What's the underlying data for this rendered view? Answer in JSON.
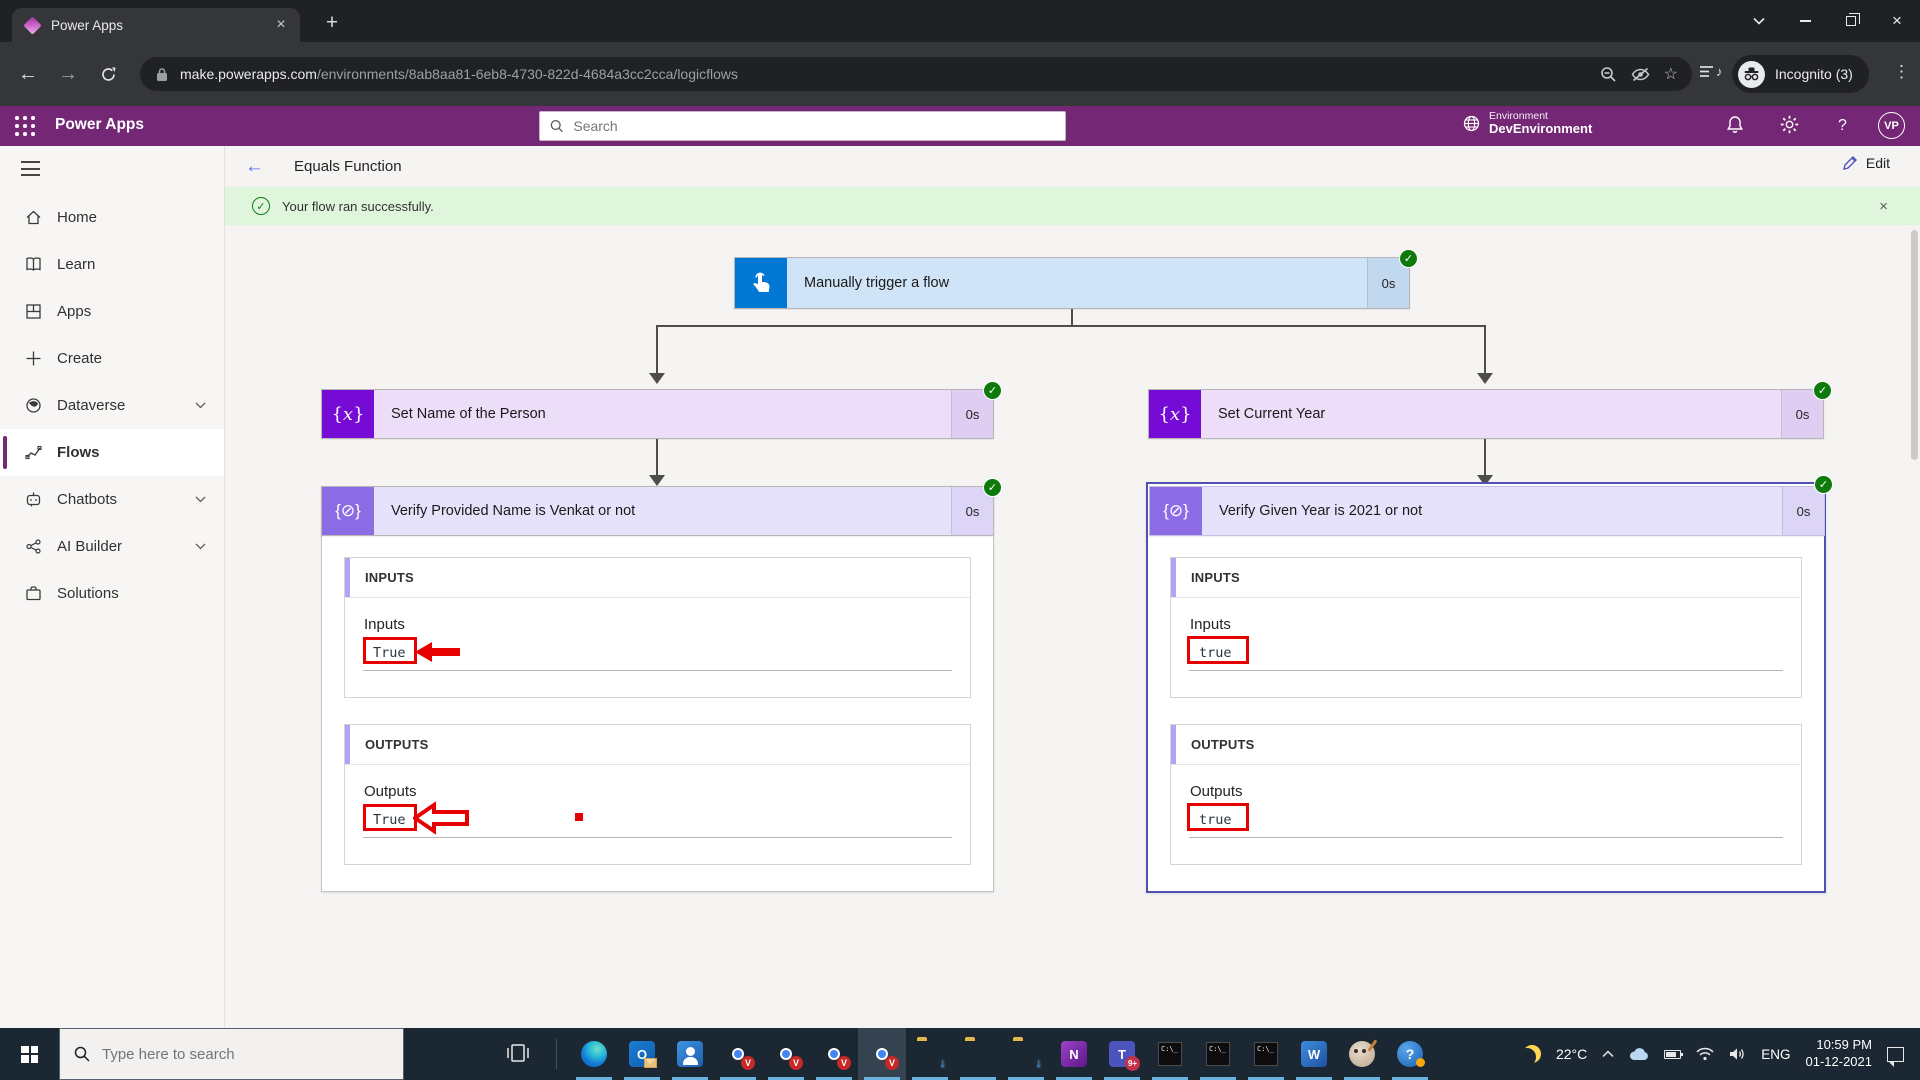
{
  "browser": {
    "tab_title": "Power Apps",
    "url_domain": "make.powerapps.com",
    "url_path": "/environments/8ab8aa81-6eb8-4730-822d-4684a3cc2cca/logicflows",
    "incognito_label": "Incognito (3)"
  },
  "app_header": {
    "brand": "Power Apps",
    "search_placeholder": "Search",
    "environment_label": "Environment",
    "environment_name": "DevEnvironment",
    "avatar_initials": "VP"
  },
  "sidebar": {
    "items": [
      {
        "label": "Home",
        "icon": "home-icon"
      },
      {
        "label": "Learn",
        "icon": "book-icon"
      },
      {
        "label": "Apps",
        "icon": "apps-grid-icon"
      },
      {
        "label": "Create",
        "icon": "plus-icon"
      },
      {
        "label": "Dataverse",
        "icon": "dataverse-icon",
        "chevron": true
      },
      {
        "label": "Flows",
        "icon": "flows-icon",
        "selected": true
      },
      {
        "label": "Chatbots",
        "icon": "chatbot-icon",
        "chevron": true
      },
      {
        "label": "AI Builder",
        "icon": "ai-builder-icon",
        "chevron": true
      },
      {
        "label": "Solutions",
        "icon": "solutions-icon"
      }
    ]
  },
  "page": {
    "title": "Equals Function",
    "edit_label": "Edit",
    "banner_text": "Your flow ran successfully."
  },
  "flow": {
    "trigger": {
      "title": "Manually trigger a flow",
      "duration": "0s"
    },
    "set_name": {
      "title": "Set Name of the Person",
      "duration": "0s"
    },
    "set_year": {
      "title": "Set Current Year",
      "duration": "0s"
    },
    "verify_name": {
      "title": "Verify Provided Name is Venkat or not",
      "duration": "0s",
      "inputs_header": "INPUTS",
      "inputs_label": "Inputs",
      "inputs_value": "True",
      "outputs_header": "OUTPUTS",
      "outputs_label": "Outputs",
      "outputs_value": "True"
    },
    "verify_year": {
      "title": "Verify Given Year is 2021 or not",
      "duration": "0s",
      "inputs_header": "INPUTS",
      "inputs_label": "Inputs",
      "inputs_value": "true",
      "outputs_header": "OUTPUTS",
      "outputs_label": "Outputs",
      "outputs_value": "true"
    }
  },
  "taskbar": {
    "search_placeholder": "Type here to search",
    "icons": [
      "edge",
      "outlook",
      "people",
      "chrome",
      "chrome",
      "chrome",
      "chrome-active",
      "folder-download",
      "folder",
      "folder-download",
      "onenote",
      "teams",
      "terminal",
      "terminal",
      "terminal",
      "word",
      "gimp",
      "get-help"
    ],
    "tray": {
      "temperature": "22°C",
      "language": "ENG",
      "time": "10:59 PM",
      "date": "01-12-2021"
    }
  },
  "glyphs": {
    "close": "×",
    "plus": "+",
    "check": "✓",
    "back": "←",
    "forward": "→",
    "kebab": "⋮",
    "star": "☆",
    "note": "♪",
    "help": "?",
    "var_open": "{",
    "var_x": "x",
    "var_close": "}",
    "compose_mid": "⊘",
    "outlook_o": "O",
    "onenote_n": "N",
    "teams_t": "T",
    "teams_count": "9+",
    "word_w": "W",
    "chrome_badge": "V",
    "terminal_text": "C:\\_",
    "download_arrow": "↓"
  },
  "colors": {
    "brand": "#742774",
    "blue": "#0078d4",
    "purple": "#770bd6",
    "lpurple": "#8b6ce5",
    "green": "#0e7a0b",
    "sel": "#4f52b2",
    "red": "#e60000",
    "banner": "#dff6dd",
    "task": "#1b2733",
    "uline": "#6cb2e0"
  }
}
